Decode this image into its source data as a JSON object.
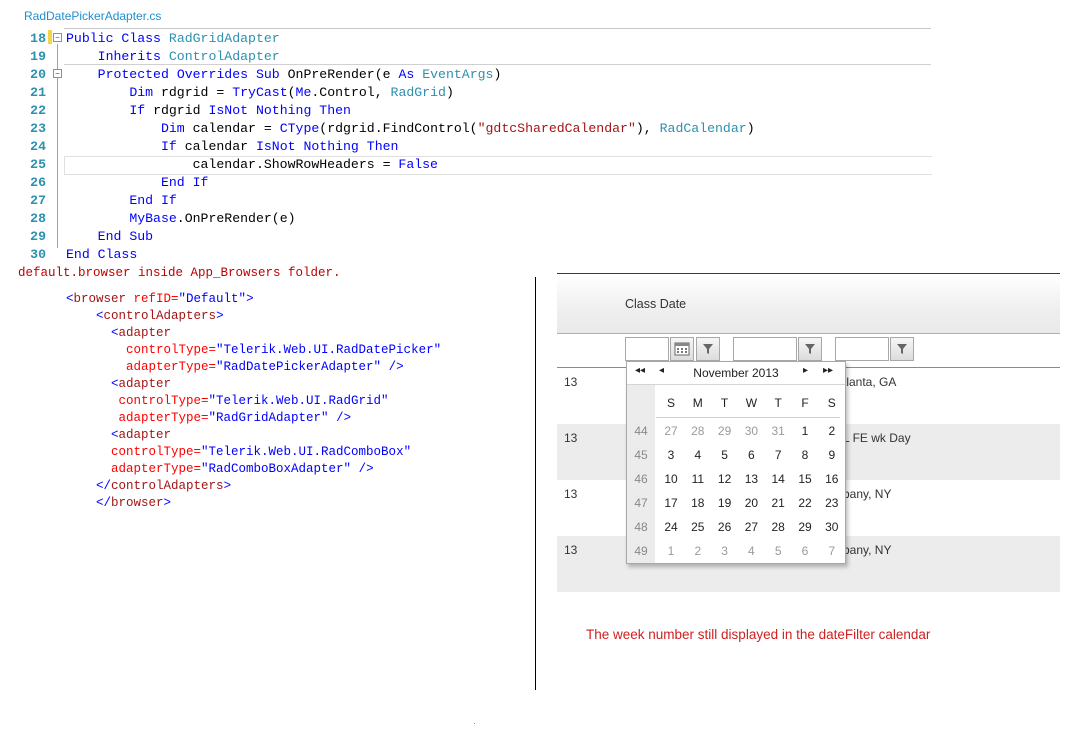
{
  "file_tab": "RadDatePickerAdapter.cs",
  "code_lines": [
    {
      "num": "18",
      "text": "Public Class RadGridAdapter"
    },
    {
      "num": "19",
      "text": "    Inherits ControlAdapter"
    },
    {
      "num": "20",
      "text": "    Protected Overrides Sub OnPreRender(e As EventArgs)"
    },
    {
      "num": "21",
      "text": "        Dim rdgrid = TryCast(Me.Control, RadGrid)"
    },
    {
      "num": "22",
      "text": "        If rdgrid IsNot Nothing Then"
    },
    {
      "num": "23",
      "text": "            Dim calendar = CType(rdgrid.FindControl(\"gdtcSharedCalendar\"), RadCalendar)"
    },
    {
      "num": "24",
      "text": "            If calendar IsNot Nothing Then"
    },
    {
      "num": "25",
      "text": "                calendar.ShowRowHeaders = False"
    },
    {
      "num": "26",
      "text": "            End If"
    },
    {
      "num": "27",
      "text": "        End If"
    },
    {
      "num": "28",
      "text": "        MyBase.OnPreRender(e)"
    },
    {
      "num": "29",
      "text": "    End Sub"
    },
    {
      "num": "30",
      "text": "End Class"
    }
  ],
  "xml_caption": "default.browser inside App_Browsers folder.",
  "xml_lines": [
    "<browser refID=\"Default\">",
    "    <controlAdapters>",
    "      <adapter",
    "        controlType=\"Telerik.Web.UI.RadDatePicker\"",
    "        adapterType=\"RadDatePickerAdapter\" />",
    "      <adapter",
    "       controlType=\"Telerik.Web.UI.RadGrid\"",
    "       adapterType=\"RadGridAdapter\" />",
    "      <adapter",
    "      controlType=\"Telerik.Web.UI.RadComboBox\"",
    "      adapterType=\"RadComboBoxAdapter\" />",
    "    </controlAdapters>",
    "    </browser>"
  ],
  "grid": {
    "column_header": "Class Date",
    "rows": [
      {
        "c1": "13",
        "c3": "tlanta, GA"
      },
      {
        "c1": "13",
        "c3": "L FE wk Day"
      },
      {
        "c1": "13",
        "c3": "bany, NY"
      },
      {
        "c1": "13",
        "c3": "bany, NY"
      }
    ]
  },
  "calendar": {
    "title": "November 2013",
    "nav": {
      "fast_prev": "◂◂",
      "prev": "◂",
      "next": "▸",
      "fast_next": "▸▸"
    },
    "days_of_week": [
      "S",
      "M",
      "T",
      "W",
      "T",
      "F",
      "S"
    ],
    "weeks": [
      {
        "num": "44",
        "days": [
          "27",
          "28",
          "29",
          "30",
          "31",
          "1",
          "2"
        ]
      },
      {
        "num": "45",
        "days": [
          "3",
          "4",
          "5",
          "6",
          "7",
          "8",
          "9"
        ]
      },
      {
        "num": "46",
        "days": [
          "10",
          "11",
          "12",
          "13",
          "14",
          "15",
          "16"
        ]
      },
      {
        "num": "47",
        "days": [
          "17",
          "18",
          "19",
          "20",
          "21",
          "22",
          "23"
        ]
      },
      {
        "num": "48",
        "days": [
          "24",
          "25",
          "26",
          "27",
          "28",
          "29",
          "30"
        ]
      },
      {
        "num": "49",
        "days": [
          "1",
          "2",
          "3",
          "4",
          "5",
          "6",
          "7"
        ]
      }
    ]
  },
  "annotation": "The week number still displayed in the dateFilter calendar"
}
